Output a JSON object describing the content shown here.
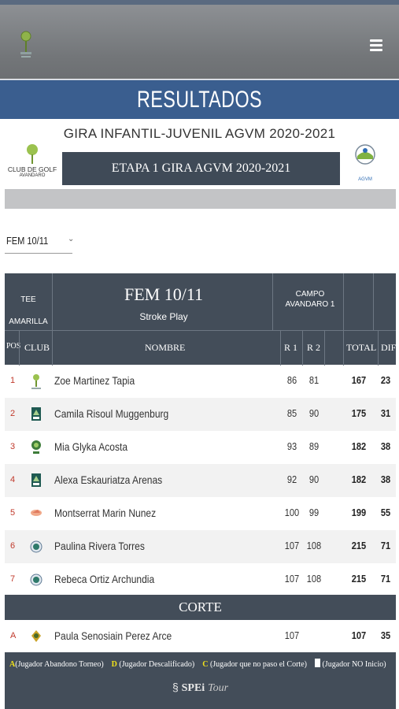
{
  "header": {
    "title": "RESULTADOS"
  },
  "event": {
    "title": "GIRA INFANTIL-JUVENIL AGVM 2020-2021",
    "stage": "ETAPA 1 GIRA AGVM 2020-2021",
    "club_logo_line1": "CLUB DE GOLF",
    "club_logo_line2": "AVANDARO",
    "agvm_logo_text": "AGVM"
  },
  "category_select": {
    "value": "FEM 10/11"
  },
  "table": {
    "tee_line1": "TEE",
    "tee_line2": "AMARILLA",
    "category": "FEM 10/11",
    "format": "Stroke Play",
    "campo_line1": "CAMPO",
    "campo_line2": "AVANDARO 1",
    "columns": {
      "pos": "POS",
      "club": "CLUB",
      "name": "NOMBRE",
      "r1": "R 1",
      "r2": "R 2",
      "total": "TOTAL",
      "dif": "DIF"
    },
    "rows": [
      {
        "pos": "1",
        "name": "Zoe Martinez Tapia",
        "r1": "86",
        "r2": "81",
        "total": "167",
        "dif": "23",
        "club_icon": "avandaro-club-icon"
      },
      {
        "pos": "2",
        "name": "Camila Risoul Muggenburg",
        "r1": "85",
        "r2": "90",
        "total": "175",
        "dif": "31",
        "club_icon": "club-crest-icon"
      },
      {
        "pos": "3",
        "name": "Mia Glyka Acosta",
        "r1": "93",
        "r2": "89",
        "total": "182",
        "dif": "38",
        "club_icon": "tree-club-icon"
      },
      {
        "pos": "4",
        "name": "Alexa Eskauriatza Arenas",
        "r1": "92",
        "r2": "90",
        "total": "182",
        "dif": "38",
        "club_icon": "club-crest-icon"
      },
      {
        "pos": "5",
        "name": "Montserrat Marin Nunez",
        "r1": "100",
        "r2": "99",
        "total": "199",
        "dif": "55",
        "club_icon": "bird-club-icon"
      },
      {
        "pos": "6",
        "name": "Paulina Rivera Torres",
        "r1": "107",
        "r2": "108",
        "total": "215",
        "dif": "71",
        "club_icon": "round-club-icon"
      },
      {
        "pos": "7",
        "name": "Rebeca Ortiz Archundia",
        "r1": "107",
        "r2": "108",
        "total": "215",
        "dif": "71",
        "club_icon": "round-club-icon"
      }
    ],
    "cut_label": "CORTE",
    "after_cut": [
      {
        "pos": "A",
        "name": "Paula Senosiain Perez Arce",
        "r1": "107",
        "r2": "",
        "total": "107",
        "dif": "35",
        "club_icon": "emblem-club-icon"
      }
    ]
  },
  "legend": {
    "a_key": "A",
    "a_text": "(Jugador Abandono Torneo)",
    "d_key": "D",
    "d_text": "(Jugador Descalificado)",
    "c_key": "C",
    "c_text": "(Jugador que no paso el Corte)",
    "blank_text": "(Jugador NO Inicio)"
  },
  "footer": {
    "brand": "SPEi",
    "brand_suffix": "Tour"
  },
  "colors": {
    "title_bar": "#3a5e8f",
    "table_header": "#434d59",
    "position_red": "#c0392b",
    "legend_yellow": "#f1e21a"
  }
}
